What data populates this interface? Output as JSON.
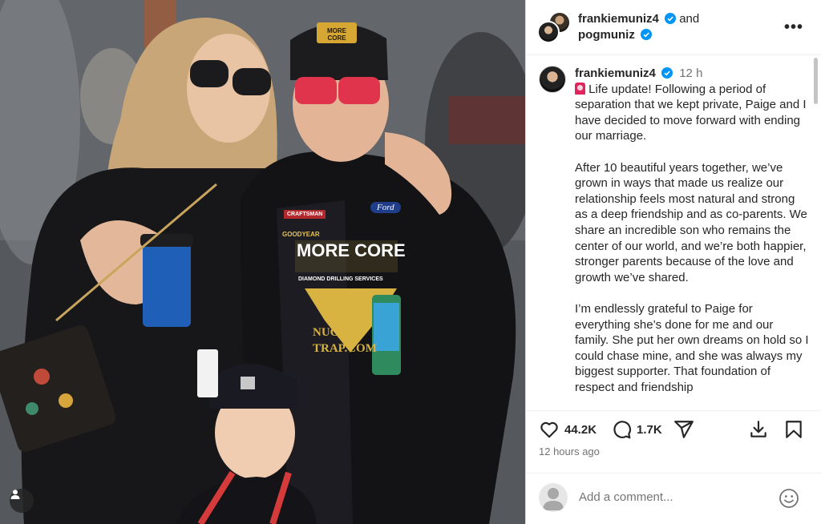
{
  "header": {
    "user1": "frankiemuniz4",
    "connector": "and",
    "user2": "pogmuniz",
    "more_label": "•••"
  },
  "caption": {
    "username": "frankiemuniz4",
    "time": "12 h",
    "paragraphs": [
      " Life update!  Following a period of separation that we kept private, Paige and I have decided to move forward with ending our marriage.",
      "After 10 beautiful years together, we’ve grown in ways that made us realize our relationship feels most natural and strong as a deep friendship and as co-parents. We share an incredible son who remains the center of our world, and we’re both happier, stronger parents because of the love and growth we’ve shared.",
      "I’m endlessly grateful to Paige for everything she’s done for me and our family. She put her own dreams on hold so I could chase mine, and she was always my biggest supporter. That foundation of respect and friendship"
    ]
  },
  "actions": {
    "likes": "44.2K",
    "comments": "1.7K"
  },
  "timeago": "12 hours ago",
  "comment_box": {
    "placeholder": "Add a comment..."
  },
  "photo": {
    "cap_text": "MORE CORE",
    "suit_brand": "MORE CORE",
    "suit_sub": "DIAMOND DRILLING SERVICES",
    "suit_sponsor": "NUGGET TRAP.COM",
    "ford": "Ford",
    "goodyear": "GOODYEAR",
    "craftsman": "CRAFTSMAN"
  },
  "colors": {
    "verified": "#0095f6",
    "text": "#262626",
    "muted": "#737373"
  }
}
